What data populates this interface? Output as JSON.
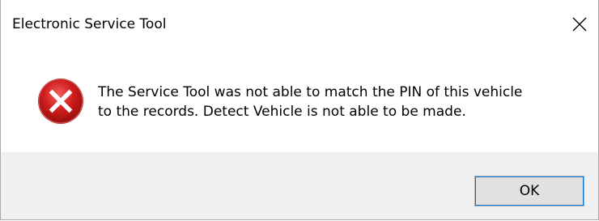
{
  "window": {
    "title": "Electronic Service Tool",
    "close_glyph": "×"
  },
  "message": {
    "icon": "error-icon",
    "line1": "The Service Tool was not able to match the PIN of this vehicle",
    "line2": "to the records. Detect Vehicle is not able to be made."
  },
  "buttons": {
    "ok_label": "OK"
  },
  "colors": {
    "error_red": "#d01d1d",
    "focus_blue": "#0078d7",
    "footer_bg": "#f0f0f0"
  }
}
